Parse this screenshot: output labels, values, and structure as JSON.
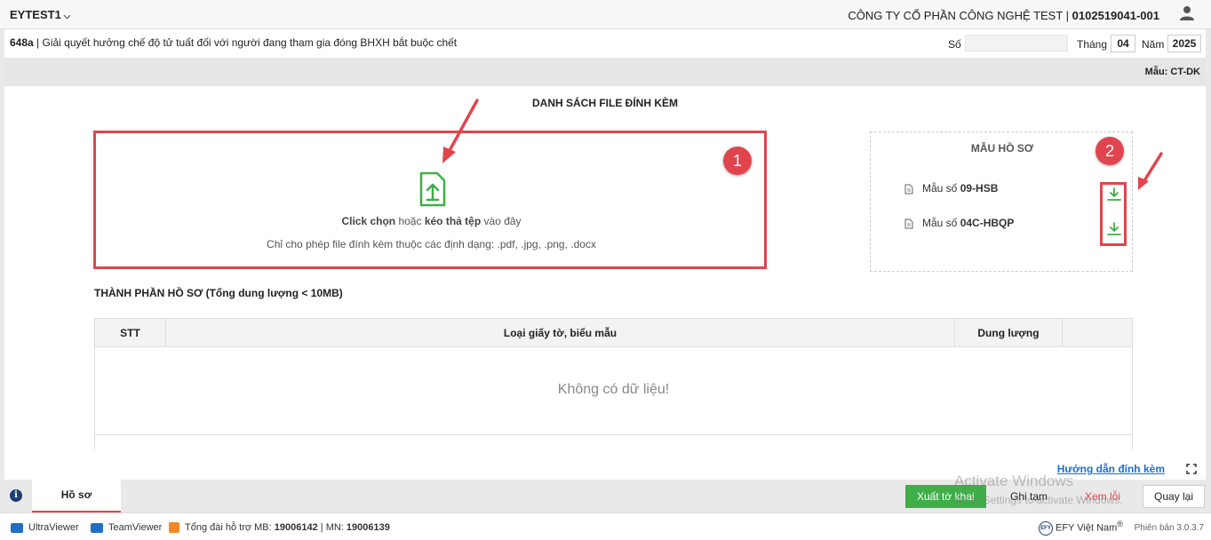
{
  "header": {
    "org_name": "EYTEST1",
    "company_name": "CÔNG TY CỔ PHẦN CÔNG NGHỆ TEST | ",
    "tax_code": "0102519041-001"
  },
  "form": {
    "code": "648a",
    "title": " | Giải quyết hưởng chế độ tử tuất đối với người đang tham gia đóng BHXH bắt buộc chết",
    "so_label": "Số",
    "so_value": "",
    "thang_label": "Tháng",
    "thang_value": "04",
    "nam_label": "Năm",
    "nam_value": "2025",
    "mau_code": "Mẫu: CT-DK"
  },
  "attachments": {
    "section_title": "DANH SÁCH FILE ĐÍNH KÈM",
    "click_text": "Click chọn",
    "or_text": " hoặc ",
    "drag_text": "kéo thả tệp",
    "here_text": " vào đây",
    "formats_text": "Chỉ cho phép file đính kèm thuộc các định dạng: .pdf, .jpg, .png, .docx"
  },
  "templates": {
    "title": "MẪU HỒ SƠ",
    "items": [
      {
        "prefix": "Mẫu số ",
        "code": "09-HSB"
      },
      {
        "prefix": "Mẫu số ",
        "code": "04C-HBQP"
      }
    ]
  },
  "annotations": {
    "badge1": "1",
    "badge2": "2"
  },
  "components": {
    "title": "THÀNH PHẦN HỒ SƠ (Tổng dung lượng < 10MB)",
    "columns": [
      "STT",
      "Loại giấy tờ, biểu mẫu",
      "Dung lượng",
      ""
    ],
    "empty_message": "Không có dữ liệu!"
  },
  "help": {
    "link": "Hướng dẫn đính kèm"
  },
  "bottom": {
    "tab_label": "Hồ sơ",
    "export_label": "Xuất tờ khai",
    "save_label": "Ghi tạm",
    "error_label": "Xem lỗi",
    "back_label": "Quay lại",
    "watermark_title": "Activate Windows",
    "watermark_sub": "Go to Settings to activate Windows."
  },
  "status": {
    "ultraviewer": "UltraViewer",
    "teamviewer": "TeamViewer",
    "hotline_label": "Tổng đài hỗ trợ MB: ",
    "hotline_mb": "19006142",
    "hotline_sep": " | MN: ",
    "hotline_mn": "19006139",
    "brand": "EFY Việt Nam",
    "brand_mark": "®",
    "version": "Phiên bản 3.0.3.7"
  },
  "colors": {
    "accent_red": "#e0454d",
    "green": "#3fae49",
    "link_blue": "#1a6fd1"
  }
}
